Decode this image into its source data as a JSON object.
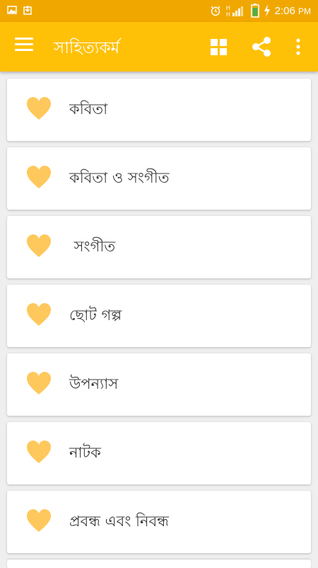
{
  "status_bar": {
    "time": "2:06",
    "ampm": "PM",
    "icons": [
      "image-icon",
      "download-icon",
      "alarm-icon",
      "signal-icon",
      "battery-icon",
      "charging-icon"
    ]
  },
  "app_bar": {
    "title": "সাহিত্যকর্ম",
    "actions": [
      "menu-icon",
      "grid-view-icon",
      "share-icon",
      "more-vert-icon"
    ]
  },
  "colors": {
    "status_bar": "#f0a800",
    "app_bar": "#ffc107",
    "heart": "#ffc85c",
    "background": "#efefef"
  },
  "items": [
    {
      "label": "কবিতা",
      "icon": "heart-icon"
    },
    {
      "label": "কবিতা ও সংগীত",
      "icon": "heart-icon"
    },
    {
      "label": " সংগীত",
      "icon": "heart-icon"
    },
    {
      "label": "ছোট গল্প",
      "icon": "heart-icon"
    },
    {
      "label": "উপন্যাস",
      "icon": "heart-icon"
    },
    {
      "label": "নাটক",
      "icon": "heart-icon"
    },
    {
      "label": "প্রবন্ধ এবং নিবন্ধ",
      "icon": "heart-icon"
    }
  ]
}
